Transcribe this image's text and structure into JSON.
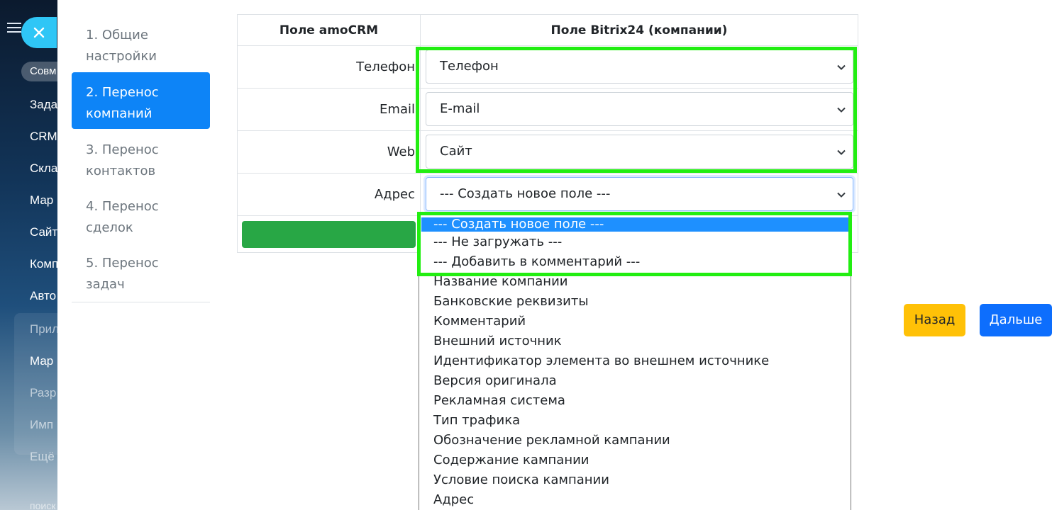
{
  "background_sidebar": {
    "items": [
      "Совм",
      "Зада",
      "CRM",
      "Скла",
      "Мар",
      "Сайт",
      "Комп",
      "Авто",
      "Прил",
      "Мар",
      "Разр",
      "Имп",
      "Ещё"
    ],
    "footer": "поиск"
  },
  "close_label": "×",
  "steps": [
    {
      "label": "1. Общие настройки",
      "active": false
    },
    {
      "label": "2. Перенос компаний",
      "active": true
    },
    {
      "label": "3. Перенос контактов",
      "active": false
    },
    {
      "label": "4. Перенос сделок",
      "active": false
    },
    {
      "label": "5. Перенос задач",
      "active": false
    }
  ],
  "table": {
    "headers": [
      "Поле amoCRM",
      "Поле Bitrix24 (компании)"
    ],
    "rows": [
      {
        "label": "Телефон",
        "value": "Телефон"
      },
      {
        "label": "Email",
        "value": "E-mail"
      },
      {
        "label": "Web",
        "value": "Сайт"
      },
      {
        "label": "Адрес",
        "value": "--- Создать новое поле ---"
      }
    ]
  },
  "buttons": {
    "back": "Назад",
    "next": "Дальше"
  },
  "dropdown": {
    "selected_index": 0,
    "options": [
      "--- Создать новое поле ---",
      "--- Не загружать ---",
      "--- Добавить в комментарий ---",
      "Название компании",
      "Банковские реквизиты",
      "Комментарий",
      "Внешний источник",
      "Идентификатор элемента во внешнем источнике",
      "Версия оригинала",
      "Рекламная система",
      "Тип трафика",
      "Обозначение рекламной кампании",
      "Содержание кампании",
      "Условие поиска кампании",
      "Адрес"
    ]
  },
  "colors": {
    "accent": "#0d84f7",
    "highlight": "#22ee11",
    "back_button": "#ffc107",
    "next_button": "#0d6efd",
    "save_bar": "#28a745"
  }
}
